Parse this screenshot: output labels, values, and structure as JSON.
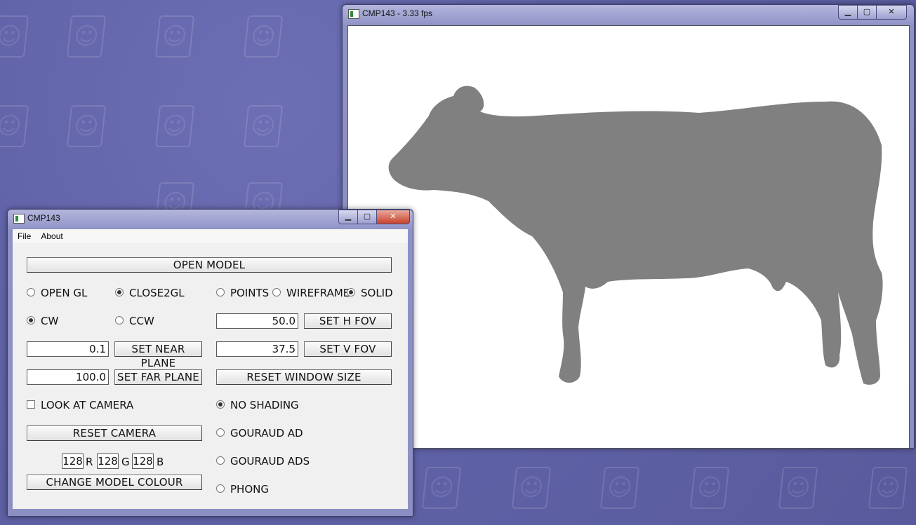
{
  "gl_window": {
    "title": "CMP143 - 3.33 fps",
    "model_color": "#808080"
  },
  "control_window": {
    "title": "CMP143",
    "menu": [
      "File",
      "About"
    ],
    "open_model_label": "OPEN MODEL",
    "renderer": {
      "opengl_label": "OPEN GL",
      "close2gl_label": "CLOSE2GL",
      "selected": "CLOSE2GL"
    },
    "primitive": {
      "points_label": "POINTS",
      "wireframe_label": "WIREFRAME",
      "solid_label": "SOLID",
      "selected": "SOLID"
    },
    "winding": {
      "cw_label": "CW",
      "ccw_label": "CCW",
      "selected": "CW"
    },
    "h_fov": {
      "value": "50.0",
      "button": "SET H FOV"
    },
    "v_fov": {
      "value": "37.5",
      "button": "SET V FOV"
    },
    "near_plane": {
      "value": "0.1",
      "button": "SET NEAR PLANE"
    },
    "far_plane": {
      "value": "100.0",
      "button": "SET FAR PLANE"
    },
    "reset_window_label": "RESET WINDOW SIZE",
    "look_at_label": "LOOK AT CAMERA",
    "look_at_checked": false,
    "reset_camera_label": "RESET CAMERA",
    "shading": {
      "options": [
        "NO SHADING",
        "GOURAUD AD",
        "GOURAUD ADS",
        "PHONG"
      ],
      "selected": "NO SHADING"
    },
    "color": {
      "r": "128",
      "g": "128",
      "b": "128",
      "r_label": "R",
      "g_label": "G",
      "b_label": "B"
    },
    "change_color_label": "CHANGE MODEL COLOUR"
  }
}
